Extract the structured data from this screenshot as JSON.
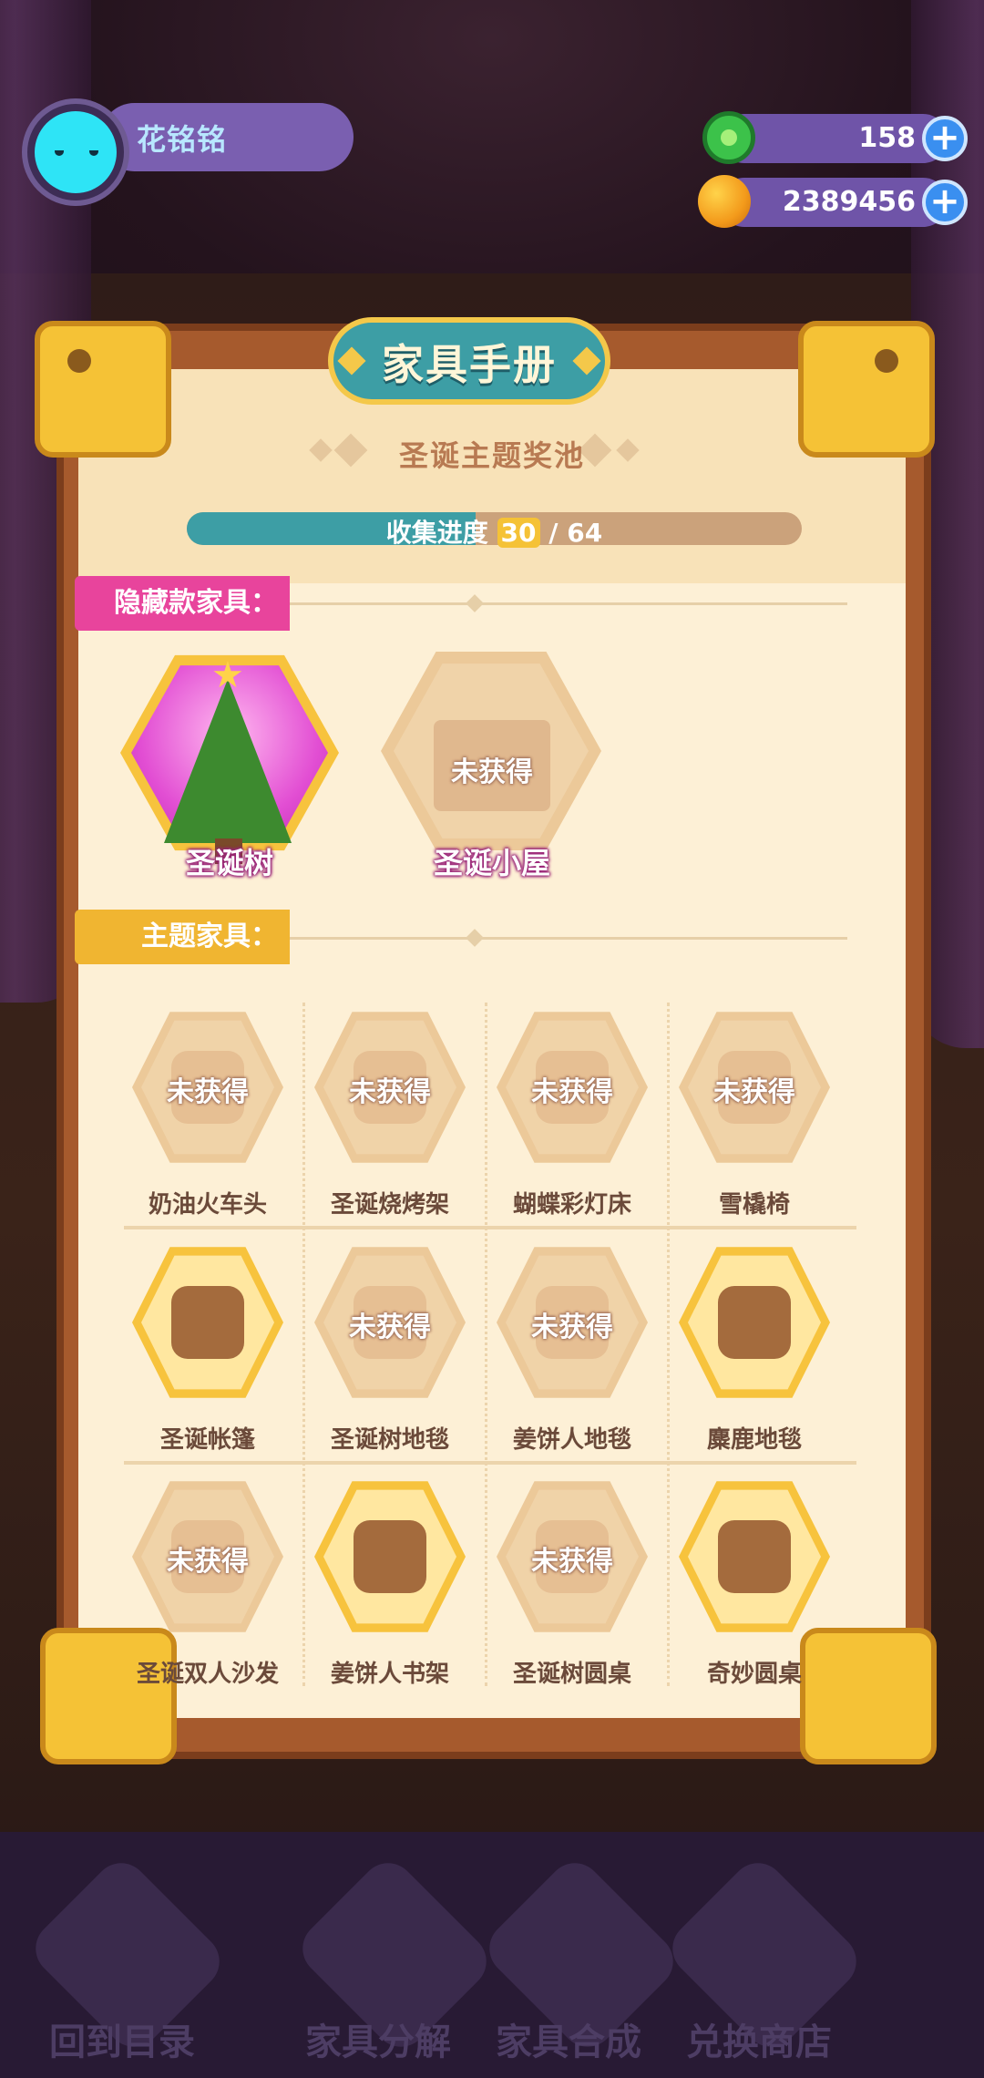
{
  "user": {
    "name": "花铭铭"
  },
  "currencies": [
    {
      "icon": "donut-gem-icon",
      "value": "158"
    },
    {
      "icon": "coin-planet-icon",
      "value": "2389456"
    }
  ],
  "panel": {
    "title": "家具手册",
    "subtitle": "圣诞主题奖池",
    "progress": {
      "label": "收集进度",
      "current": "30",
      "total": "64",
      "fraction": 0.47
    }
  },
  "hidden_section": {
    "title": "隐藏款家具：",
    "items": [
      {
        "name": "圣诞树",
        "owned": true,
        "icon": "christmas-tree-icon"
      },
      {
        "name": "圣诞小屋",
        "owned": false,
        "icon": "christmas-house-icon",
        "locked_label": "未获得"
      }
    ]
  },
  "theme_section": {
    "title": "主题家具：",
    "locked_label": "未获得",
    "items": [
      {
        "name": "奶油火车头",
        "owned": false,
        "icon": "cream-train-icon"
      },
      {
        "name": "圣诞烧烤架",
        "owned": false,
        "icon": "grill-icon"
      },
      {
        "name": "蝴蝶彩灯床",
        "owned": false,
        "icon": "bed-icon"
      },
      {
        "name": "雪橇椅",
        "owned": false,
        "icon": "sled-chair-icon"
      },
      {
        "name": "圣诞帐篷",
        "owned": true,
        "icon": "tent-icon"
      },
      {
        "name": "圣诞树地毯",
        "owned": false,
        "icon": "tree-rug-icon"
      },
      {
        "name": "姜饼人地毯",
        "owned": false,
        "icon": "gingerbread-rug-icon"
      },
      {
        "name": "麋鹿地毯",
        "owned": true,
        "icon": "reindeer-rug-icon"
      },
      {
        "name": "圣诞双人沙发",
        "owned": false,
        "icon": "sofa-icon"
      },
      {
        "name": "姜饼人书架",
        "owned": true,
        "icon": "bookshelf-icon"
      },
      {
        "name": "圣诞树圆桌",
        "owned": false,
        "icon": "round-table-icon"
      },
      {
        "name": "奇妙圆桌",
        "owned": true,
        "icon": "wonder-table-icon"
      }
    ]
  },
  "bottom_nav": [
    {
      "label": "回到目录",
      "icon": "back-icon"
    },
    {
      "label": "家具分解",
      "icon": "puzzle-icon"
    },
    {
      "label": "家具合成",
      "icon": "hammer-icon"
    },
    {
      "label": "兑换商店",
      "icon": "gift-icon"
    }
  ]
}
